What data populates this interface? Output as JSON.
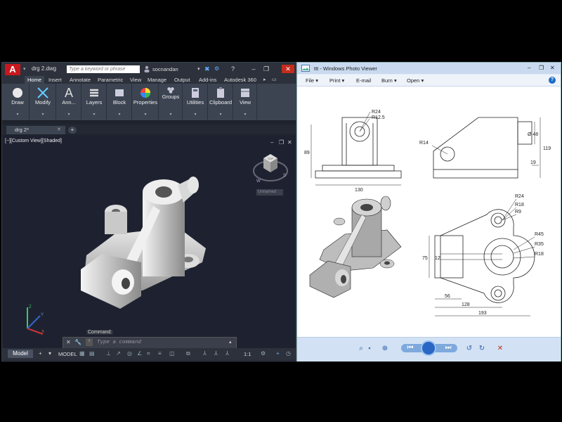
{
  "acad": {
    "logo": "A",
    "doc_title": "drg 2.dwg",
    "search_placeholder": "Type a keyword or phrase",
    "user": "socnandan",
    "tabs": [
      "Home",
      "Insert",
      "Annotate",
      "Parametric",
      "View",
      "Manage",
      "Output",
      "Add-ins",
      "Autodesk 360"
    ],
    "panels": [
      "Draw",
      "Modify",
      "Ann...",
      "Layers",
      "Block",
      "Properties",
      "Groups",
      "Utilities",
      "Clipboard",
      "View"
    ],
    "doc_tab": "drg 2*",
    "viewport_label": "[−][Custom View][Shaded]",
    "viewcube_label": "Unnamed",
    "command_label": "Command:",
    "command_placeholder": "Type a command",
    "model_tab": "Model",
    "status_model": "MODEL",
    "status_scale": "1:1",
    "compass": {
      "n": "N",
      "w": "W",
      "s": "S"
    },
    "cube_face": "TOP",
    "ucs": {
      "x": "X",
      "y": "Y",
      "z": "Z"
    }
  },
  "pv": {
    "title": "ttt - Windows Photo Viewer",
    "menu": [
      "File",
      "Print",
      "E-mail",
      "Burn",
      "Open"
    ],
    "help": "?"
  },
  "drawing": {
    "top_left": {
      "r24": "R24",
      "r125": "R12.5",
      "d89": "89",
      "d130": "130"
    },
    "top_right": {
      "r14": "R14",
      "d48": "Ø 48",
      "d19": "19",
      "d119": "119"
    },
    "bottom_right": {
      "r24": "R24",
      "r18a": "R18",
      "r9": "R9",
      "r45": "R45",
      "r35": "R35",
      "r18b": "R18",
      "d75": "75",
      "d12": "12",
      "d56": "56",
      "d128": "128",
      "d193": "193"
    }
  }
}
